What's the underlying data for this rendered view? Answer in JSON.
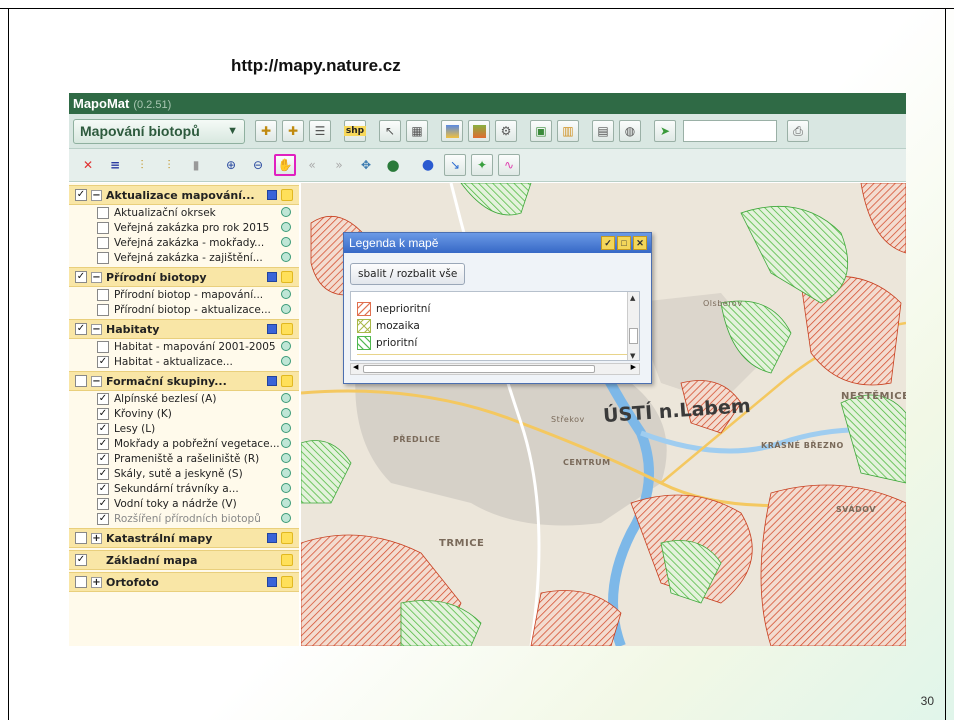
{
  "slide": {
    "url": "http://mapy.nature.cz",
    "page_number": "30"
  },
  "app": {
    "name": "MapoMat",
    "version": "(0.2.51)"
  },
  "toolbar": {
    "map_select": "Mapování biotopů",
    "icons_row1": [
      "add-layer-icon",
      "add-layer-alt-icon",
      "list-icon",
      "shp-icon",
      "measure-icon",
      "table-icon",
      "layers-color-icon",
      "layers-grey-icon",
      "settings-icon",
      "export-icon",
      "book-icon",
      "map-icon",
      "kml-icon",
      "analysis-icon",
      "print-icon"
    ],
    "shp_label": "shp",
    "icons_row2": [
      "remove-icon",
      "list-all-icon",
      "legend-icon",
      "legend-alt-icon",
      "eraser-icon",
      "zoom-in-icon",
      "zoom-out-icon",
      "pan-icon",
      "back-icon",
      "forward-icon",
      "full-extent-icon",
      "globe-icon",
      "info-icon",
      "select-icon",
      "draw-icon",
      "feature-icon"
    ]
  },
  "layers": [
    {
      "title": "Aktualizace mapování...",
      "checked": true,
      "expanded": true,
      "items": [
        {
          "label": "Aktualizační okrsek",
          "checked": false
        },
        {
          "label": "Veřejná zakázka pro rok 2015",
          "checked": false
        },
        {
          "label": "Veřejná zakázka - mokřady...",
          "checked": false
        },
        {
          "label": "Veřejná zakázka - zajištění...",
          "checked": false
        }
      ]
    },
    {
      "title": "Přírodní biotopy",
      "checked": true,
      "expanded": true,
      "items": [
        {
          "label": "Přírodní biotop - mapování...",
          "checked": false
        },
        {
          "label": "Přírodní biotop - aktualizace...",
          "checked": false
        }
      ]
    },
    {
      "title": "Habitaty",
      "checked": true,
      "expanded": true,
      "items": [
        {
          "label": "Habitat - mapování 2001-2005",
          "checked": false
        },
        {
          "label": "Habitat - aktualizace...",
          "checked": true
        }
      ]
    },
    {
      "title": "Formační skupiny...",
      "checked": false,
      "expanded": true,
      "items": [
        {
          "label": "Alpínské bezlesí (A)",
          "checked": true
        },
        {
          "label": "Křoviny (K)",
          "checked": true
        },
        {
          "label": "Lesy (L)",
          "checked": true
        },
        {
          "label": "Mokřady a pobřežní vegetace...",
          "checked": true
        },
        {
          "label": "Prameniště a rašeliniště (R)",
          "checked": true
        },
        {
          "label": "Skály, sutě a jeskyně (S)",
          "checked": true
        },
        {
          "label": "Sekundární trávníky a...",
          "checked": true
        },
        {
          "label": "Vodní toky a nádrže (V)",
          "checked": true
        },
        {
          "label": "Rozšíření přírodních biotopů",
          "checked": true,
          "muted": true
        }
      ]
    },
    {
      "title": "Katastrální mapy",
      "checked": false,
      "expanded": false,
      "items": []
    },
    {
      "title": "Základní mapa",
      "checked": true,
      "noToggle": true,
      "items": []
    },
    {
      "title": "Ortofoto",
      "checked": false,
      "expanded": false,
      "items": []
    }
  ],
  "map": {
    "labels": {
      "city": "ÚSTÍ n.Labem",
      "centrum": "CENTRUM",
      "trmice": "TRMICE",
      "stredov": "Střekov",
      "sebuzin": "SVÁDOV",
      "krasne": "KRÁSNÉ BŘEZNO",
      "ustim": "NESTĚMICE",
      "predlice": "PŘEDLICE",
      "stredohor": "Olsberov"
    }
  },
  "legend": {
    "title": "Legenda k mapě",
    "collapse_label": "sbalit / rozbalit vše",
    "items": [
      {
        "label": "neprioritní",
        "color": "#e07050"
      },
      {
        "label": "mozaika",
        "color": "#a8b848"
      },
      {
        "label": "prioritní",
        "color": "#50b850"
      }
    ]
  }
}
